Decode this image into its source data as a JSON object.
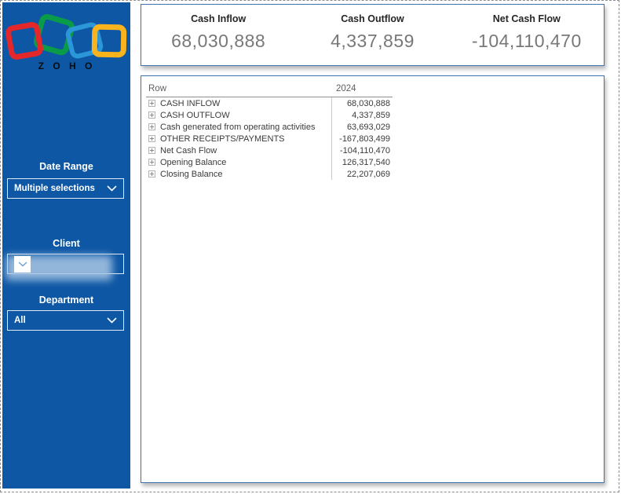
{
  "sidebar": {
    "logo": {
      "text": "Z O H O"
    },
    "date_range": {
      "label": "Date Range",
      "value": "Multiple selections"
    },
    "client": {
      "label": "Client",
      "value_redacted": true
    },
    "department": {
      "label": "Department",
      "value": "All"
    }
  },
  "kpis": [
    {
      "label": "Cash Inflow",
      "value": "68,030,888"
    },
    {
      "label": "Cash Outflow",
      "value": "4,337,859"
    },
    {
      "label": "Net Cash Flow",
      "value": "-104,110,470"
    }
  ],
  "table": {
    "columns": [
      "Row",
      "2024"
    ],
    "rows": [
      {
        "label": "CASH INFLOW",
        "value": "68,030,888"
      },
      {
        "label": "CASH OUTFLOW",
        "value": "4,337,859"
      },
      {
        "label": "Cash generated from operating activities",
        "value": "63,693,029"
      },
      {
        "label": "OTHER RECEIPTS/PAYMENTS",
        "value": "-167,803,499"
      },
      {
        "label": "Net Cash Flow",
        "value": "-104,110,470"
      },
      {
        "label": "Opening Balance",
        "value": "126,317,540"
      },
      {
        "label": "Closing Balance",
        "value": "22,207,069"
      }
    ]
  },
  "icons": {
    "expand": "plus-box",
    "chevron": "chevron-down"
  },
  "colors": {
    "sidebar_blue": "#0e57a5",
    "panel_border": "#3d74ad",
    "kpi_value_gray": "#787878",
    "logo_red": "#e4272b",
    "logo_green": "#0a9b48",
    "logo_blue": "#2b97d9",
    "logo_yellow": "#f9b31d"
  }
}
